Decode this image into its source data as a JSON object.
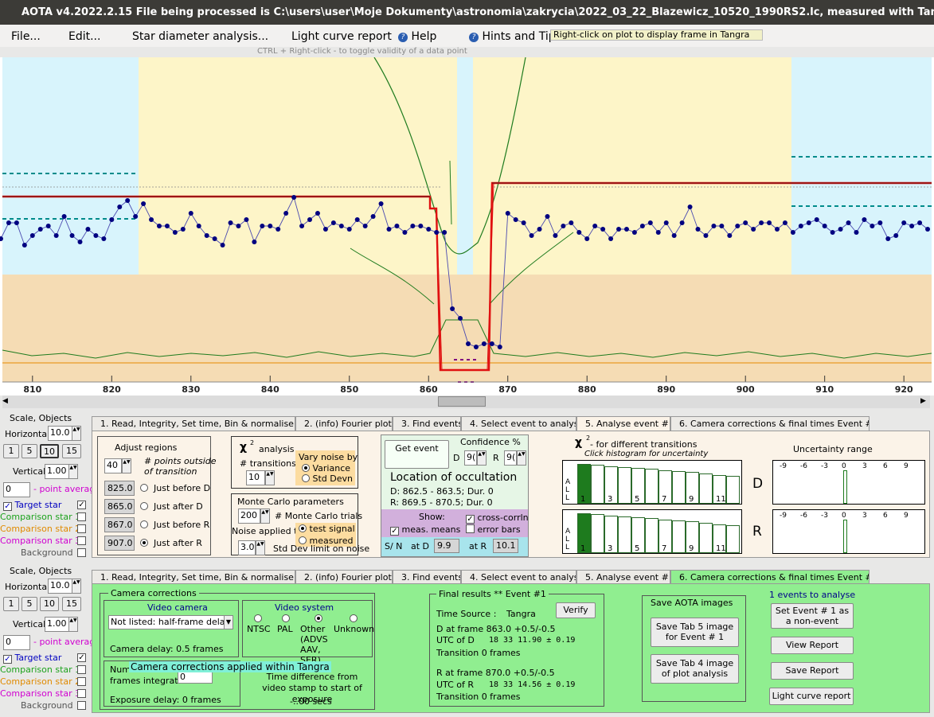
{
  "title": "AOTA v4.2022.2.15    File being processed is C:\\users\\user\\Moje Dokumenty\\astronomia\\zakrycia\\2022_03_22_Blazewicz_10520_1990RS2.lc, measured with Tangra",
  "menu": {
    "file": "File...",
    "edit": "Edit...",
    "star_diameter": "Star diameter analysis...",
    "lc_report": "Light curve report",
    "help": "Help",
    "hints": "Hints and Tips"
  },
  "tooltip": "Right-click on plot to display frame in Tangra",
  "hint": "CTRL + Right-click   -   to toggle validity of a data point",
  "plot": {
    "x_ticks": [
      "810",
      "820",
      "830",
      "840",
      "850",
      "860",
      "870",
      "880",
      "890",
      "900",
      "910",
      "920"
    ]
  },
  "chart_data": {
    "type": "line",
    "x_range": [
      806.2,
      923.5
    ],
    "y_range": [
      0,
      1
    ],
    "points": [
      [
        806,
        0.43
      ],
      [
        807,
        0.48
      ],
      [
        808,
        0.48
      ],
      [
        809,
        0.41
      ],
      [
        810,
        0.44
      ],
      [
        811,
        0.46
      ],
      [
        812,
        0.47
      ],
      [
        813,
        0.44
      ],
      [
        814,
        0.5
      ],
      [
        815,
        0.44
      ],
      [
        816,
        0.42
      ],
      [
        817,
        0.46
      ],
      [
        818,
        0.44
      ],
      [
        819,
        0.43
      ],
      [
        820,
        0.49
      ],
      [
        821,
        0.53
      ],
      [
        822,
        0.55
      ],
      [
        823,
        0.5
      ],
      [
        824,
        0.54
      ],
      [
        825,
        0.49
      ],
      [
        826,
        0.47
      ],
      [
        827,
        0.47
      ],
      [
        828,
        0.45
      ],
      [
        829,
        0.46
      ],
      [
        830,
        0.51
      ],
      [
        831,
        0.47
      ],
      [
        832,
        0.44
      ],
      [
        833,
        0.43
      ],
      [
        834,
        0.41
      ],
      [
        835,
        0.48
      ],
      [
        836,
        0.47
      ],
      [
        837,
        0.49
      ],
      [
        838,
        0.42
      ],
      [
        839,
        0.47
      ],
      [
        840,
        0.47
      ],
      [
        841,
        0.46
      ],
      [
        842,
        0.51
      ],
      [
        843,
        0.56
      ],
      [
        844,
        0.47
      ],
      [
        845,
        0.49
      ],
      [
        846,
        0.51
      ],
      [
        847,
        0.46
      ],
      [
        848,
        0.48
      ],
      [
        849,
        0.47
      ],
      [
        850,
        0.46
      ],
      [
        851,
        0.49
      ],
      [
        852,
        0.47
      ],
      [
        853,
        0.5
      ],
      [
        854,
        0.54
      ],
      [
        855,
        0.46
      ],
      [
        856,
        0.47
      ],
      [
        857,
        0.45
      ],
      [
        858,
        0.47
      ],
      [
        859,
        0.47
      ],
      [
        860,
        0.46
      ],
      [
        861,
        0.45
      ],
      [
        862,
        0.45
      ],
      [
        863,
        0.21
      ],
      [
        864,
        0.18
      ],
      [
        865,
        0.1
      ],
      [
        866,
        0.09
      ],
      [
        867,
        0.1
      ],
      [
        868,
        0.1
      ],
      [
        869,
        0.09
      ],
      [
        870,
        0.51
      ],
      [
        871,
        0.49
      ],
      [
        872,
        0.48
      ],
      [
        873,
        0.44
      ],
      [
        874,
        0.46
      ],
      [
        875,
        0.5
      ],
      [
        876,
        0.44
      ],
      [
        877,
        0.47
      ],
      [
        878,
        0.48
      ],
      [
        879,
        0.45
      ],
      [
        880,
        0.43
      ],
      [
        881,
        0.47
      ],
      [
        882,
        0.46
      ],
      [
        883,
        0.43
      ],
      [
        884,
        0.46
      ],
      [
        885,
        0.46
      ],
      [
        886,
        0.45
      ],
      [
        887,
        0.47
      ],
      [
        888,
        0.48
      ],
      [
        889,
        0.45
      ],
      [
        890,
        0.48
      ],
      [
        891,
        0.44
      ],
      [
        892,
        0.48
      ],
      [
        893,
        0.53
      ],
      [
        894,
        0.46
      ],
      [
        895,
        0.44
      ],
      [
        896,
        0.47
      ],
      [
        897,
        0.47
      ],
      [
        898,
        0.44
      ],
      [
        899,
        0.47
      ],
      [
        900,
        0.48
      ],
      [
        901,
        0.46
      ],
      [
        902,
        0.48
      ],
      [
        903,
        0.48
      ],
      [
        904,
        0.46
      ],
      [
        905,
        0.48
      ],
      [
        906,
        0.45
      ],
      [
        907,
        0.47
      ],
      [
        908,
        0.48
      ],
      [
        909,
        0.49
      ],
      [
        910,
        0.47
      ],
      [
        911,
        0.45
      ],
      [
        912,
        0.46
      ],
      [
        913,
        0.48
      ],
      [
        914,
        0.45
      ],
      [
        915,
        0.49
      ],
      [
        916,
        0.47
      ],
      [
        917,
        0.48
      ],
      [
        918,
        0.43
      ],
      [
        919,
        0.44
      ],
      [
        920,
        0.48
      ],
      [
        921,
        0.47
      ],
      [
        922,
        0.48
      ],
      [
        923,
        0.46
      ]
    ]
  },
  "side": {
    "scale_objects": "Scale, Objects",
    "horizontal": "Horizontal",
    "horizontal_val": "10.0",
    "steps": [
      "1",
      "5",
      "10",
      "15"
    ],
    "vertical": "Vertical",
    "vertical_val": "1.00",
    "avg_val": "0",
    "avg_label": "- point average",
    "target": "Target star",
    "comp1": "Comparison star 1",
    "comp2": "Comparison star 2",
    "comp3": "Comparison star 3",
    "background": "Background"
  },
  "tabs": [
    "1.  Read, Integrity, Set time, Bin & normalise",
    "2. (info)  Fourier plot",
    "3. Find events",
    "4. Select event to analyse",
    "5. Analyse event #1",
    "6. Camera corrections & final times Event #1"
  ],
  "tab5": {
    "adjust_title": "Adjust regions",
    "pts_val": "40",
    "pts_label1": "# points outside",
    "pts_label2": "of transition",
    "values": [
      "825.0",
      "865.0",
      "867.0",
      "907.0"
    ],
    "labels": [
      "Just before D",
      "Just after D",
      "Just before R",
      "Just after R"
    ],
    "chi_title": "analysis",
    "chi_sym": "χ",
    "trans_label": "# transitions",
    "trans_val": "10",
    "vary_title": "Vary noise by",
    "vary_opts": [
      "Variance",
      "Std Devn"
    ],
    "mc_title": "Monte Carlo parameters",
    "mc_val": "200",
    "mc_label": "# Monte Carlo trials",
    "noise_applied": "Noise applied to",
    "noise_opts": [
      "test signal",
      "measured"
    ],
    "std_val": "3.0",
    "std_label": "Std Dev limit on noise",
    "get_event": "Get event",
    "confidence": "Confidence %",
    "conf_d": "9(",
    "conf_r": "9(",
    "loc_title": "Location of occultation",
    "loc_d": "D: 862.5 - 863.5; Dur. 0",
    "loc_r": "R: 869.5 - 870.5; Dur. 0",
    "show": "Show:",
    "meas_means": "meas. means",
    "cross_corr": "cross-corrln",
    "error_bars": "error bars",
    "sn": "S/ N",
    "at_d": "at D",
    "sn_d": "9.9",
    "at_r": "at R",
    "sn_r": "10.1",
    "chi2_title": "  -  for different transitions",
    "chi2_sub": "Click histogram for uncertainty",
    "unc_title": "Uncertainty range",
    "hist_labels": [
      "1",
      "3",
      "5",
      "7",
      "9",
      "11"
    ],
    "unc_ticks": [
      "-9",
      "-6",
      "-3",
      "0",
      "3",
      "6",
      "9"
    ],
    "d": "D",
    "r": "R",
    "all": "A L L"
  },
  "tab6": {
    "cam_corr": "Camera corrections",
    "video_camera": "Video camera",
    "camera_select": "Not listed: half-frame delay",
    "camera_delay": "Camera delay: 0.5 frames",
    "video_system": "Video system",
    "vs_opts": [
      "NTSC",
      "PAL",
      "Other (ADVS AAV, SER)",
      "Unknown"
    ],
    "num_frames": "Num",
    "frames_integrated": "frames integrated",
    "frames_val": "0",
    "overlay": "Camera corrections applied within Tangra",
    "time_diff": "Time difference from video stamp to start of exposure",
    "time_val": "-..00 secs",
    "exposure_delay": "Exposure delay:  0 frames",
    "final_title": "Final results  **  Event #1",
    "time_source": "Time Source :",
    "tangra": "Tangra",
    "verify": "Verify",
    "d_frame": "D     at frame 863.0  +0.5/-0.5",
    "utc_d_label": "UTC of D",
    "utc_d": "18 33 11.90 ± 0.19",
    "trans_d": "Transition  0 frames",
    "r_frame": "R     at frame 870.0  +0.5/-0.5",
    "utc_r_label": "UTC of R",
    "utc_r": "18 33 14.56 ± 0.19",
    "trans_r": "Transition  0 frames",
    "save_title": "Save AOTA images",
    "save5": "Save Tab 5 image for Event # 1",
    "save4": "Save Tab 4 image of plot analysis",
    "events_label": "1 events to analyse",
    "set_non": "Set Event # 1 as a non-event",
    "view_report": "View Report",
    "save_report": "Save Report",
    "lc_report": "Light curve report"
  },
  "colors": {
    "red": "#e01010",
    "green": "#1e7b1e",
    "navy": "#000080",
    "teal": "#008b8b",
    "orange": "#e68a00"
  }
}
